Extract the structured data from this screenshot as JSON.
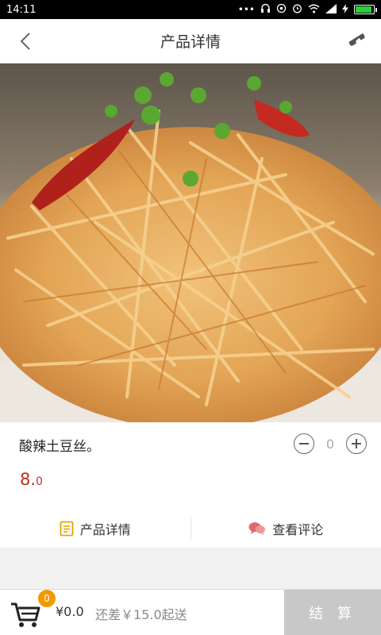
{
  "status_bar": {
    "time": "14:11",
    "signal_text": "..."
  },
  "nav": {
    "title": "产品详情"
  },
  "product": {
    "name": "酸辣土豆丝。",
    "price_int": "8.",
    "price_dec": "0",
    "quantity": "0"
  },
  "tabs": [
    {
      "label": "产品详情"
    },
    {
      "label": "查看评论"
    }
  ],
  "cart": {
    "badge": "0",
    "total": "¥0.0",
    "shortfall": "还差￥15.0起送",
    "checkout_label": "结 算"
  },
  "colors": {
    "price": "#c02a26",
    "badge": "#f39800",
    "comment_icon": "#e06a6a",
    "detail_icon": "#e2a600"
  }
}
